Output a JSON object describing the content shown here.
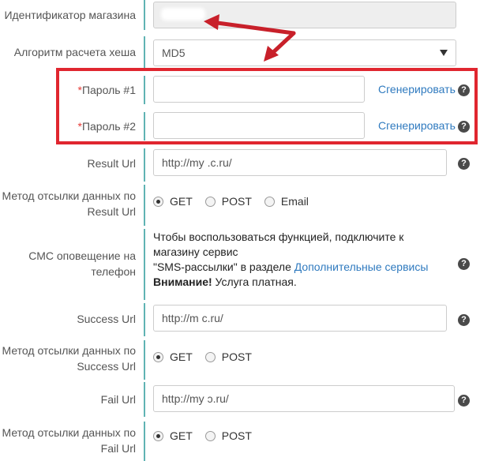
{
  "form": {
    "shop_id": {
      "label": "Идентификатор магазина",
      "value": ""
    },
    "hash_algo": {
      "label": "Алгоритм расчета хеша",
      "value": "MD5"
    },
    "password1": {
      "req": "*",
      "label": "Пароль #1",
      "value": "",
      "generate": "Сгенерировать",
      "help": "?"
    },
    "password2": {
      "req": "*",
      "label": "Пароль #2",
      "value": "",
      "generate": "Сгенерировать",
      "help": "?"
    },
    "result_url": {
      "label": "Result Url",
      "value": "http://my            .c.ru/",
      "help": "?"
    },
    "result_method": {
      "label_line1": "Метод отсылки данных по",
      "label_line2": "Result Url",
      "options": [
        "GET",
        "POST",
        "Email"
      ],
      "selected": "GET"
    },
    "sms": {
      "label_line1": "СМС оповещение на",
      "label_line2": "телефон",
      "text_line1": "Чтобы воспользоваться функцией, подключите к",
      "text_line2": "магазину сервис",
      "text_line3_a": "\"SMS-рассылки\" в разделе ",
      "text_line3_link": "Дополнительные сервисы",
      "text_line4_bold": "Внимание!",
      "text_line4_rest": " Услуга платная.",
      "help": "?"
    },
    "success_url": {
      "label": "Success Url",
      "value": "http://m               c.ru/",
      "help": "?"
    },
    "success_method": {
      "label_line1": "Метод отсылки данных по",
      "label_line2": "Success Url",
      "options": [
        "GET",
        "POST"
      ],
      "selected": "GET"
    },
    "fail_url": {
      "label": "Fail Url",
      "value": "http://my              ᴐ.ru/",
      "help": "?"
    },
    "fail_method": {
      "label_line1": "Метод отсылки данных по",
      "label_line2": "Fail Url",
      "options": [
        "GET",
        "POST"
      ],
      "selected": "GET"
    }
  },
  "colors": {
    "accent_link": "#2f7abf",
    "divider": "#5fb3b3",
    "highlight": "#e0262f",
    "required": "#e53935"
  },
  "icons": {
    "help": "question-circle-icon",
    "select": "chevron-down-icon"
  }
}
